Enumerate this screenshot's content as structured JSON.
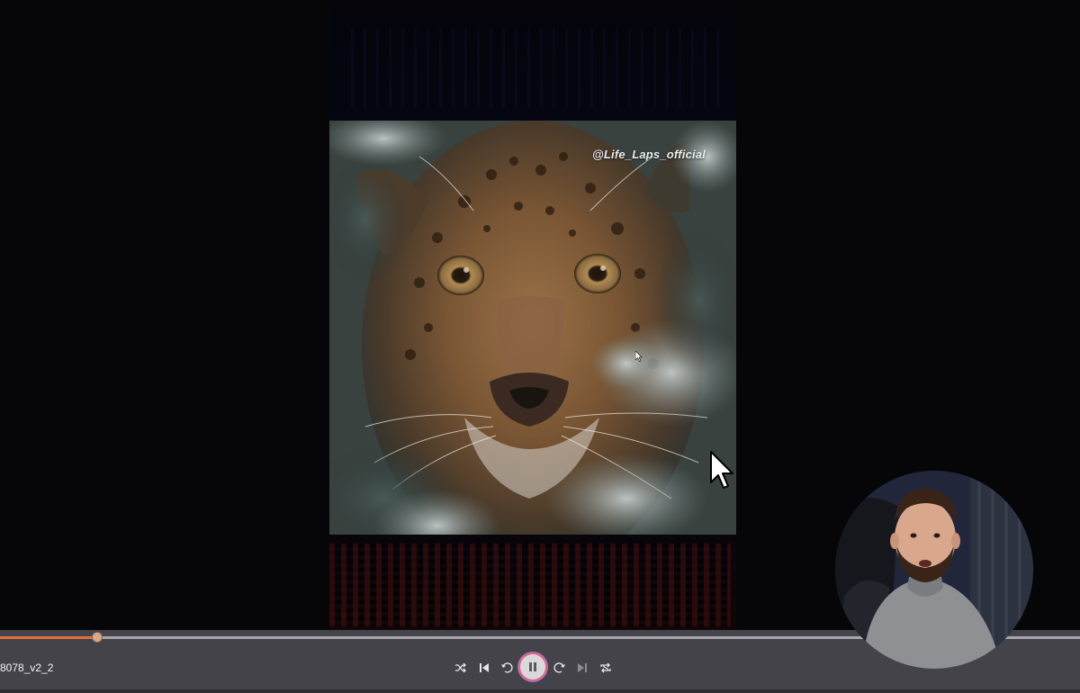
{
  "video": {
    "watermark": "@Life_Laps_official",
    "subject": "jaguar-closeup"
  },
  "player": {
    "filename": "8078_v2_2",
    "progress_fraction": 0.09,
    "accent_color": "#e0703a",
    "state": "playing"
  },
  "controls": {
    "icons": [
      "shuffle-icon",
      "previous-icon",
      "rewind-icon",
      "pause-icon",
      "forward-icon",
      "next-icon",
      "repeat-icon"
    ]
  }
}
